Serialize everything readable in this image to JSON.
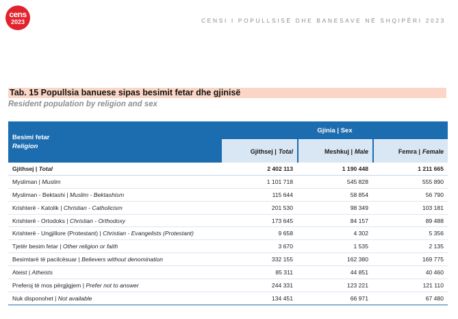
{
  "brand": {
    "logo_word": "cens",
    "logo_year": "2023",
    "header_text": "CENSI I POPULLSISË DHE BANESAVE NË SHQIPËRI 2023"
  },
  "table": {
    "title": "Tab. 15 Popullsia banuese sipas besimit fetar dhe gjinisë",
    "subtitle": "Resident population by religion and sex",
    "header": {
      "religion_sq": "Besimi fetar",
      "religion_en": "Religion",
      "gender_group": "Gjinia | Sex",
      "total_sq": "Gjithsej |",
      "total_en": "Total",
      "male_sq": "Meshkuj |",
      "male_en": "Male",
      "female_sq": "Femra |",
      "female_en": "Female"
    },
    "rows": [
      {
        "sq": "Gjithsej | ",
        "en": "Total",
        "total": "2 402 113",
        "male": "1 190 448",
        "female": "1 211 665"
      },
      {
        "sq": "Mysliman | ",
        "en": "Muslim",
        "total": "1 101 718",
        "male": "545 828",
        "female": "555 890"
      },
      {
        "sq": "Mysliman - Bektashi | ",
        "en": "Muslim - Bektashism",
        "total": "115 644",
        "male": "58 854",
        "female": "56 790"
      },
      {
        "sq": "Krishterë - Katolik | ",
        "en": "Christian - Catholicism",
        "total": "201 530",
        "male": "98 349",
        "female": "103 181"
      },
      {
        "sq": "Krishterë - Ortodoks | ",
        "en": "Christian - Orthodoxy",
        "total": "173 645",
        "male": "84 157",
        "female": "89 488"
      },
      {
        "sq": "Krishterë - Ungjillore (Protestant) | ",
        "en": "Christian - Evangelists (Protestant)",
        "total": "9 658",
        "male": "4 302",
        "female": "5 356"
      },
      {
        "sq": "Tjetër besim fetar | ",
        "en": "Other religion or faith",
        "total": "3 670",
        "male": "1 535",
        "female": "2 135"
      },
      {
        "sq": "Besimtarë të pacilcësuar | ",
        "en": "Believers without denomination",
        "total": "332 155",
        "male": "162 380",
        "female": "169 775"
      },
      {
        "sq": "Ateist | ",
        "en": "Atheists",
        "total": "85 311",
        "male": "44 851",
        "female": "40 460"
      },
      {
        "sq": "Preferoj të mos përgjigjem | ",
        "en": "Prefer not to answer",
        "total": "244 331",
        "male": "123 221",
        "female": "121 110"
      },
      {
        "sq": "Nuk disponohet | ",
        "en": "Not available",
        "total": "134 451",
        "male": "66 971",
        "female": "67 480"
      }
    ]
  }
}
